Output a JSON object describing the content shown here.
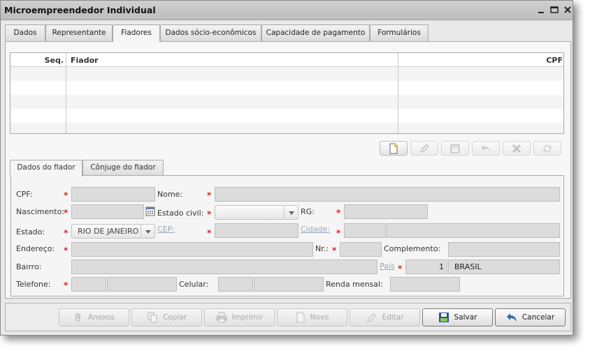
{
  "window": {
    "title": "Microempreendedor Individual"
  },
  "tabs": [
    "Dados",
    "Representante",
    "Fiadores",
    "Dados sócio-econômicos",
    "Capacidade de pagamento",
    "Formulários"
  ],
  "grid": {
    "columns": [
      "Seq.",
      "Fiador",
      "CPF"
    ],
    "rows": []
  },
  "subtabs": [
    "Dados do fiador",
    "Cônjuge do fiador"
  ],
  "form": {
    "cpf_label": "CPF:",
    "nome_label": "Nome:",
    "nascimento_label": "Nascimento:",
    "estado_civil_label": "Estado civil:",
    "rg_label": "RG:",
    "estado_label": "Estado:",
    "estado_value": "RIO DE JANEIRO",
    "cep_label": "CEP:",
    "cidade_label": "Cidade:",
    "endereco_label": "Endereço:",
    "nr_label": "Nr.:",
    "complemento_label": "Complemento:",
    "bairro_label": "Bairro:",
    "pais_label": "País",
    "pais_code": "1",
    "pais_name": "BRASIL",
    "telefone_label": "Telefone:",
    "celular_label": "Celular:",
    "renda_label": "Renda mensal:"
  },
  "actions": {
    "anexos": "Anexos",
    "copiar": "Copiar",
    "imprimir": "Imprimir",
    "novo": "Novo",
    "editar": "Editar",
    "salvar": "Salvar",
    "cancelar": "Cancelar"
  },
  "colors": {
    "required": "#d22222",
    "link_disabled": "#9aa6b8"
  }
}
